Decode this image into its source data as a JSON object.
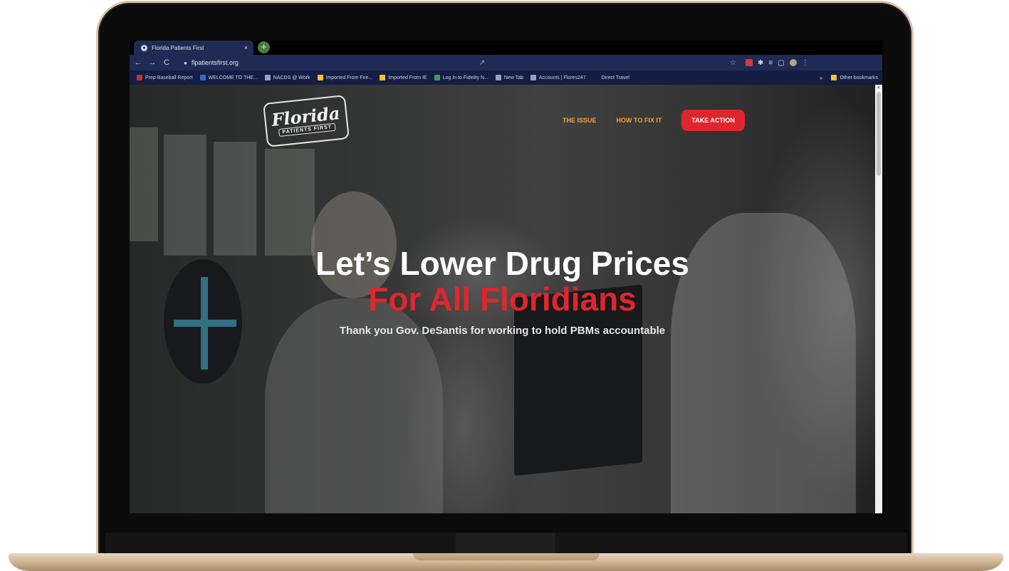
{
  "browser": {
    "tab_title": "Florida Patients First",
    "tab_close": "×",
    "new_tab": "+",
    "url": "flpatientsfirst.org",
    "nav": {
      "back": "←",
      "forward": "→",
      "reload": "C"
    },
    "bookmarks": [
      {
        "label": "Prep Baseball Report",
        "color": "#c9302c"
      },
      {
        "label": "WELCOME TO THE...",
        "color": "#2a6fd6"
      },
      {
        "label": "NACDS @ Work",
        "color": "#9aa3c7"
      },
      {
        "label": "Imported From Fire...",
        "color": "#f2c230"
      },
      {
        "label": "Imported From IE",
        "color": "#f2c230"
      },
      {
        "label": "Log In to Fidelity N...",
        "color": "#3c9a5f"
      },
      {
        "label": "New Tab",
        "color": "#9aa3c7"
      },
      {
        "label": "Accounts | Flores247",
        "color": "#9aa3c7"
      },
      {
        "label": "Direct Travel",
        "color": "#141d43"
      }
    ],
    "overflow": "»",
    "other_bookmarks": "Other bookmarks"
  },
  "site": {
    "logo": {
      "script": "Florida",
      "sub": "PATIENTS FIRST"
    },
    "nav": {
      "issue": "THE ISSUE",
      "fix": "HOW TO FIX IT",
      "action": "TAKE ACTION"
    },
    "hero": {
      "headline": "Let’s Lower Drug Prices",
      "subheadline": "For All Floridians",
      "tagline": "Thank you Gov. DeSantis for working to hold PBMs accountable"
    }
  },
  "colors": {
    "accent_red": "#e0262d",
    "nav_orange": "#f0a33a",
    "chrome_blue": "#1f2a55"
  }
}
